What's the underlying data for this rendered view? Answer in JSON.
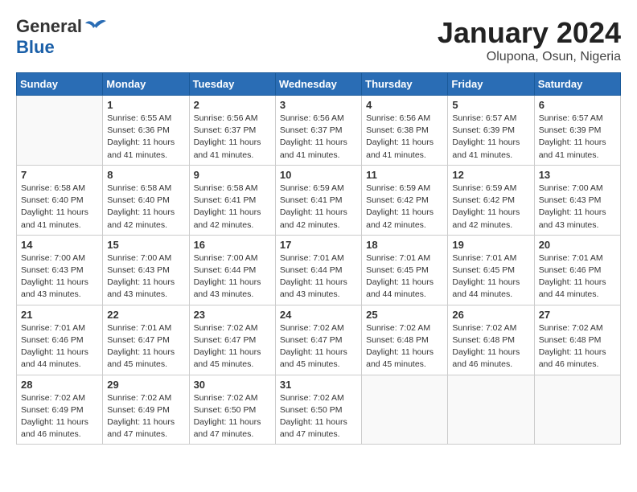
{
  "header": {
    "logo_general": "General",
    "logo_blue": "Blue",
    "month_title": "January 2024",
    "location": "Olupona, Osun, Nigeria"
  },
  "weekdays": [
    "Sunday",
    "Monday",
    "Tuesday",
    "Wednesday",
    "Thursday",
    "Friday",
    "Saturday"
  ],
  "weeks": [
    [
      {
        "day": "",
        "info": ""
      },
      {
        "day": "1",
        "info": "Sunrise: 6:55 AM\nSunset: 6:36 PM\nDaylight: 11 hours\nand 41 minutes."
      },
      {
        "day": "2",
        "info": "Sunrise: 6:56 AM\nSunset: 6:37 PM\nDaylight: 11 hours\nand 41 minutes."
      },
      {
        "day": "3",
        "info": "Sunrise: 6:56 AM\nSunset: 6:37 PM\nDaylight: 11 hours\nand 41 minutes."
      },
      {
        "day": "4",
        "info": "Sunrise: 6:56 AM\nSunset: 6:38 PM\nDaylight: 11 hours\nand 41 minutes."
      },
      {
        "day": "5",
        "info": "Sunrise: 6:57 AM\nSunset: 6:39 PM\nDaylight: 11 hours\nand 41 minutes."
      },
      {
        "day": "6",
        "info": "Sunrise: 6:57 AM\nSunset: 6:39 PM\nDaylight: 11 hours\nand 41 minutes."
      }
    ],
    [
      {
        "day": "7",
        "info": "Sunrise: 6:58 AM\nSunset: 6:40 PM\nDaylight: 11 hours\nand 41 minutes."
      },
      {
        "day": "8",
        "info": "Sunrise: 6:58 AM\nSunset: 6:40 PM\nDaylight: 11 hours\nand 42 minutes."
      },
      {
        "day": "9",
        "info": "Sunrise: 6:58 AM\nSunset: 6:41 PM\nDaylight: 11 hours\nand 42 minutes."
      },
      {
        "day": "10",
        "info": "Sunrise: 6:59 AM\nSunset: 6:41 PM\nDaylight: 11 hours\nand 42 minutes."
      },
      {
        "day": "11",
        "info": "Sunrise: 6:59 AM\nSunset: 6:42 PM\nDaylight: 11 hours\nand 42 minutes."
      },
      {
        "day": "12",
        "info": "Sunrise: 6:59 AM\nSunset: 6:42 PM\nDaylight: 11 hours\nand 42 minutes."
      },
      {
        "day": "13",
        "info": "Sunrise: 7:00 AM\nSunset: 6:43 PM\nDaylight: 11 hours\nand 43 minutes."
      }
    ],
    [
      {
        "day": "14",
        "info": "Sunrise: 7:00 AM\nSunset: 6:43 PM\nDaylight: 11 hours\nand 43 minutes."
      },
      {
        "day": "15",
        "info": "Sunrise: 7:00 AM\nSunset: 6:43 PM\nDaylight: 11 hours\nand 43 minutes."
      },
      {
        "day": "16",
        "info": "Sunrise: 7:00 AM\nSunset: 6:44 PM\nDaylight: 11 hours\nand 43 minutes."
      },
      {
        "day": "17",
        "info": "Sunrise: 7:01 AM\nSunset: 6:44 PM\nDaylight: 11 hours\nand 43 minutes."
      },
      {
        "day": "18",
        "info": "Sunrise: 7:01 AM\nSunset: 6:45 PM\nDaylight: 11 hours\nand 44 minutes."
      },
      {
        "day": "19",
        "info": "Sunrise: 7:01 AM\nSunset: 6:45 PM\nDaylight: 11 hours\nand 44 minutes."
      },
      {
        "day": "20",
        "info": "Sunrise: 7:01 AM\nSunset: 6:46 PM\nDaylight: 11 hours\nand 44 minutes."
      }
    ],
    [
      {
        "day": "21",
        "info": "Sunrise: 7:01 AM\nSunset: 6:46 PM\nDaylight: 11 hours\nand 44 minutes."
      },
      {
        "day": "22",
        "info": "Sunrise: 7:01 AM\nSunset: 6:47 PM\nDaylight: 11 hours\nand 45 minutes."
      },
      {
        "day": "23",
        "info": "Sunrise: 7:02 AM\nSunset: 6:47 PM\nDaylight: 11 hours\nand 45 minutes."
      },
      {
        "day": "24",
        "info": "Sunrise: 7:02 AM\nSunset: 6:47 PM\nDaylight: 11 hours\nand 45 minutes."
      },
      {
        "day": "25",
        "info": "Sunrise: 7:02 AM\nSunset: 6:48 PM\nDaylight: 11 hours\nand 45 minutes."
      },
      {
        "day": "26",
        "info": "Sunrise: 7:02 AM\nSunset: 6:48 PM\nDaylight: 11 hours\nand 46 minutes."
      },
      {
        "day": "27",
        "info": "Sunrise: 7:02 AM\nSunset: 6:48 PM\nDaylight: 11 hours\nand 46 minutes."
      }
    ],
    [
      {
        "day": "28",
        "info": "Sunrise: 7:02 AM\nSunset: 6:49 PM\nDaylight: 11 hours\nand 46 minutes."
      },
      {
        "day": "29",
        "info": "Sunrise: 7:02 AM\nSunset: 6:49 PM\nDaylight: 11 hours\nand 47 minutes."
      },
      {
        "day": "30",
        "info": "Sunrise: 7:02 AM\nSunset: 6:50 PM\nDaylight: 11 hours\nand 47 minutes."
      },
      {
        "day": "31",
        "info": "Sunrise: 7:02 AM\nSunset: 6:50 PM\nDaylight: 11 hours\nand 47 minutes."
      },
      {
        "day": "",
        "info": ""
      },
      {
        "day": "",
        "info": ""
      },
      {
        "day": "",
        "info": ""
      }
    ]
  ]
}
